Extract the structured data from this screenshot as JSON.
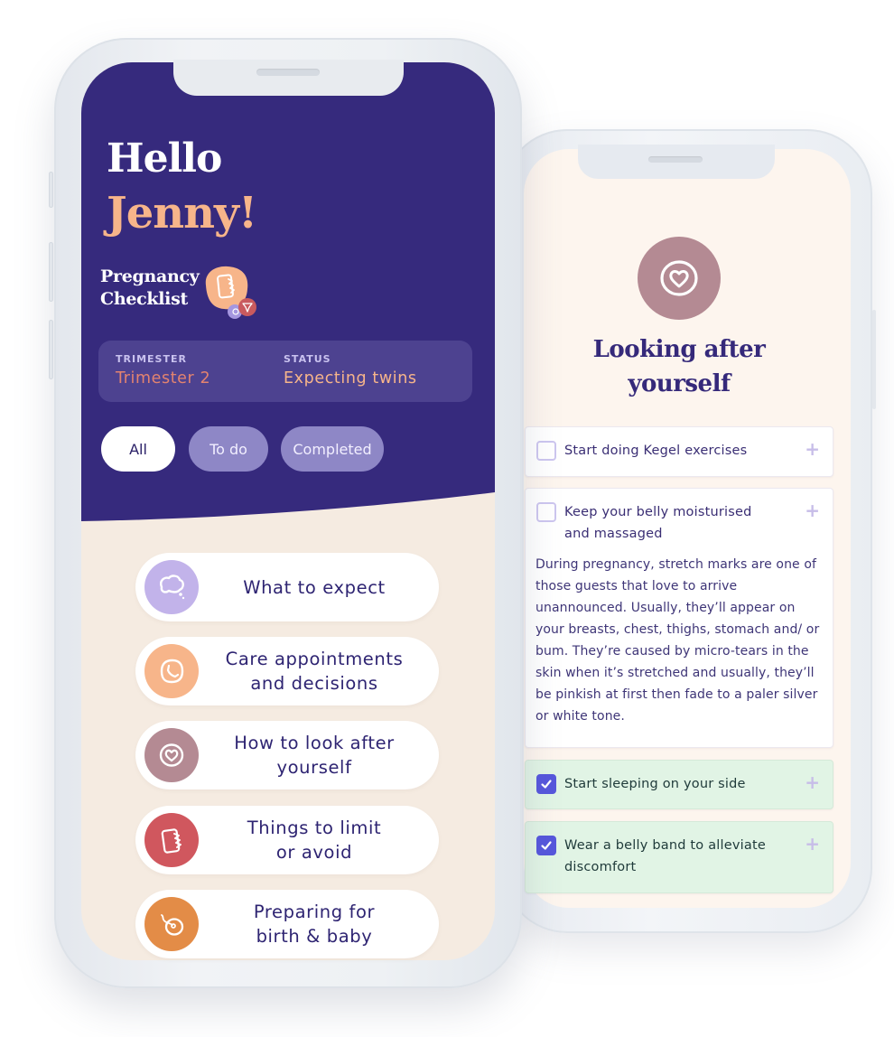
{
  "colors": {
    "header_purple": "#362a7d",
    "accent_peach": "#f7b58a",
    "accent_coral": "#e3836f",
    "cream_bg": "#f5ebe1",
    "checkbox_blue": "#5656dc",
    "done_green": "#e1f4e5",
    "title_navy": "#35297a"
  },
  "home_screen": {
    "greeting_line1": "Hello",
    "greeting_line2": "Jenny!",
    "checklist_title_line1": "Pregnancy",
    "checklist_title_line2": "Checklist",
    "checklist_icon": "checklist-notepad-icon",
    "info": {
      "trimester_label": "TRIMESTER",
      "trimester_value": "Trimester 2",
      "status_label": "STATUS",
      "status_value": "Expecting twins"
    },
    "filters": [
      {
        "label": "All",
        "active": true
      },
      {
        "label": "To do",
        "active": false
      },
      {
        "label": "Completed",
        "active": false
      }
    ],
    "categories": [
      {
        "label_line1": "What to expect",
        "label_line2": "",
        "icon": "thought-bubble-icon",
        "color": "#c2b3ea"
      },
      {
        "label_line1": "Care appointments",
        "label_line2": "and decisions",
        "icon": "phone-call-icon",
        "color": "#f7b58a"
      },
      {
        "label_line1": "How to look after",
        "label_line2": "yourself",
        "icon": "heart-icon",
        "color": "#b48a93"
      },
      {
        "label_line1": "Things to limit",
        "label_line2": "or avoid",
        "icon": "checklist-notepad-icon",
        "color": "#d0575e"
      },
      {
        "label_line1": "Preparing for",
        "label_line2": "birth & baby",
        "icon": "egg-sperm-icon",
        "color": "#e38c47"
      }
    ]
  },
  "detail_screen": {
    "icon": "heart-icon",
    "title_line1": "Looking after",
    "title_line2": "yourself",
    "tasks": [
      {
        "label": "Start doing Kegel exercises",
        "checked": false,
        "expanded": false
      },
      {
        "label": "Keep your belly moisturised and massaged",
        "checked": false,
        "expanded": true,
        "body": "During pregnancy, stretch marks are one of those guests that love to arrive unannounced. Usually, they’ll appear on your breasts, chest, thighs, stomach and/ or bum. They’re caused by micro-tears in the skin when it’s stretched and usually, they’ll be pinkish at first then fade to a paler silver or white tone."
      },
      {
        "label": "Start sleeping on your side",
        "checked": true,
        "expanded": false
      },
      {
        "label": "Wear a belly band to alleviate discomfort",
        "checked": true,
        "expanded": false
      }
    ],
    "expand_symbol": "+"
  }
}
